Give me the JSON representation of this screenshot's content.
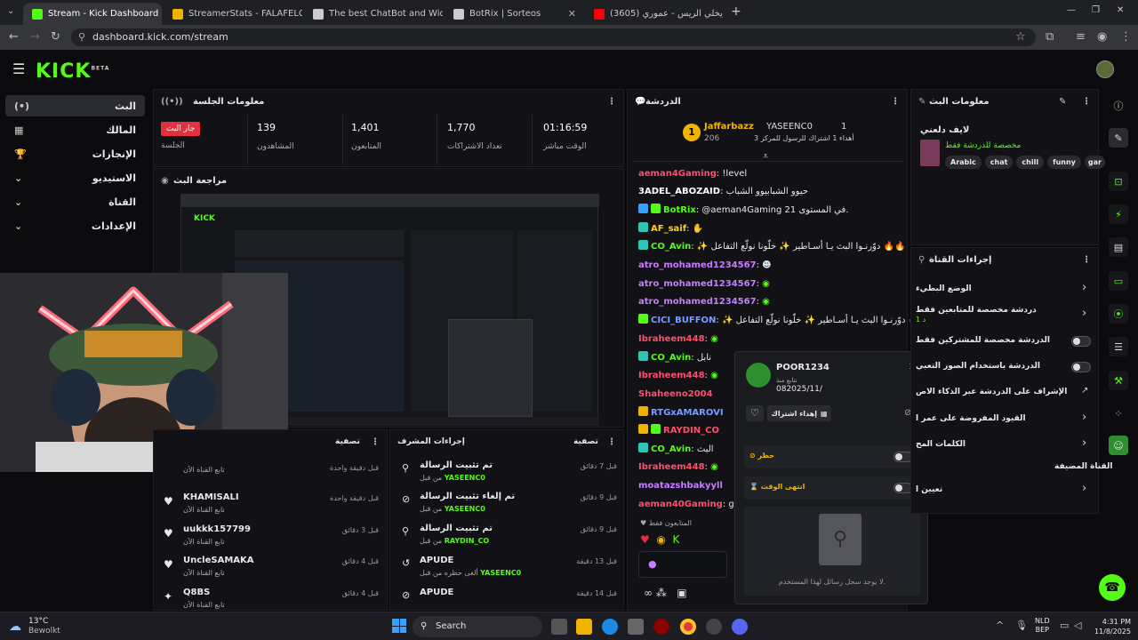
{
  "browser": {
    "tabs": [
      {
        "title": "Stream - Kick Dashboard",
        "color": "#53fc18"
      },
      {
        "title": "StreamerStats - FALAFELCO Pro",
        "color": "#f0b400"
      },
      {
        "title": "The best ChatBot and Widgets",
        "color": "#cccccc"
      },
      {
        "title": "BotRix | Sorteos",
        "color": "#cccccc"
      },
      {
        "title": "(3605) الله يخلي الريس - عموري",
        "color": "#ff0000"
      }
    ],
    "url": "dashboard.kick.com/stream"
  },
  "kick": {
    "logo": "KICK",
    "logo_sup": "BETA"
  },
  "sidebar": {
    "items": [
      {
        "label": "البث",
        "icon": "(•)"
      },
      {
        "label": "المالك",
        "icon": "▦"
      },
      {
        "label": "الإنجازات",
        "icon": "🏆"
      },
      {
        "label": "الاستيديو",
        "icon": "⌄"
      },
      {
        "label": "القناة",
        "icon": "⌄"
      },
      {
        "label": "الإعدادات",
        "icon": "⌄"
      }
    ]
  },
  "session": {
    "title": "معلومات الجلسة",
    "live_badge": "جار البث",
    "live_label": "الجلسة",
    "stats": [
      {
        "value": "139",
        "label": "المشاهدون"
      },
      {
        "value": "1,401",
        "label": "المتابعون"
      },
      {
        "value": "1,770",
        "label": "تعداد الاشتراكات"
      },
      {
        "value": "01:16:59",
        "label": "الوقت مباشر"
      }
    ]
  },
  "preview": {
    "title": "مراجعة البث"
  },
  "feed_left": {
    "title": "تصفية",
    "items": [
      {
        "name": "",
        "sub": "تابع القناة الآن",
        "time": "قبل دقيقة واحدة"
      },
      {
        "name": "",
        "sub": "تابع القناة الآن",
        "time": "قبل دقيقة واحدة"
      },
      {
        "name": "KHAMISALI",
        "sub": "تابع القناة الآن",
        "time": "قبل دقيقة واحدة"
      },
      {
        "name": "uukkk157799",
        "sub": "تابع القناة الآن",
        "time": "قبل 3 دقائق"
      },
      {
        "name": "UncleSAMAKA",
        "sub": "تابع القناة الآن",
        "time": "قبل 4 دقائق"
      },
      {
        "name": "Q8BS",
        "sub": "تابع القناة الآن",
        "time": "قبل 4 دقائق"
      }
    ]
  },
  "feed_mod": {
    "title": "إجراءات المشرف",
    "filter": "تصفية",
    "items": [
      {
        "name": "تم تثبيت الرسالة",
        "sub": "YASEENC0",
        "pre": "من قبل",
        "time": "قبل 7 دقائق"
      },
      {
        "name": "تم إلغاء تثبيت الرسالة",
        "sub": "YASEENC0",
        "pre": "من قبل",
        "time": "قبل 9 دقائق"
      },
      {
        "name": "تم تثبيت الرسالة",
        "sub": "RAYDIN_CO",
        "pre": "من قبل",
        "time": "قبل 9 دقائق"
      },
      {
        "name": "APUDE",
        "sub": "YASEENC0",
        "pre": "ألغى حظره من قبل",
        "time": "قبل 13 دقيقة"
      },
      {
        "name": "APUDE",
        "sub": "YASEENC0",
        "pre": "",
        "time": "قبل 14 دقيقة"
      }
    ]
  },
  "chat": {
    "title": "الدردشة",
    "top_user": "Jaffarbazz",
    "top_rank": "1",
    "top_value": "206",
    "second_user": "YASEENC0",
    "second_rank": "1",
    "second_sub": "3 أهداء 1 اشتراك للرسول للمركز",
    "messages": [
      {
        "user": "aeman4Gaming",
        "color": "#ff4d6d",
        "text": "!level"
      },
      {
        "user": "3ADEL_ABOZAID",
        "color": "#ffffff",
        "text": "حيوو الشبابيوو الشباب"
      },
      {
        "user": "BotRix",
        "color": "#53fc18",
        "text": "@aeman4Gaming 21 في المستوى."
      },
      {
        "user": "AF_saif",
        "color": "#ffd400",
        "text": ""
      },
      {
        "user": "CO_Avin",
        "color": "#53fc18",
        "text": "✨ دوّرنـوا البث يـا أسـاطير ✨ خلّونا نولّع التفاعل 🔥🔥"
      },
      {
        "user": "atro_mohamed1234567",
        "color": "#c77dff",
        "text": ""
      },
      {
        "user": "atro_mohamed1234567",
        "color": "#c77dff",
        "text": ""
      },
      {
        "user": "atro_mohamed1234567",
        "color": "#c77dff",
        "text": ""
      },
      {
        "user": "CICI_BUFFON",
        "color": "#7b9cff",
        "text": "✨ دوّرنـوا البث يـا أسـاطير ✨ خلّونا نولّع التفاعل 🔥🔥"
      },
      {
        "user": "Ibraheem448",
        "color": "#ff4d6d",
        "text": ""
      },
      {
        "user": "CO_Avin",
        "color": "#53fc18",
        "text": "نابل"
      },
      {
        "user": "Ibraheem448",
        "color": "#ff4d6d",
        "text": ""
      },
      {
        "user": "Shaheeno2004",
        "color": "#ff4d6d",
        "text": ""
      },
      {
        "user": "RTGxAMAROVI",
        "color": "#7b9cff",
        "text": ""
      },
      {
        "user": "RAYDIN_CO",
        "color": "#ff4d6d",
        "text": ""
      },
      {
        "user": "CO_Avin",
        "color": "#53fc18",
        "text": "البث"
      },
      {
        "user": "Ibraheem448",
        "color": "#ff4d6d",
        "text": ""
      },
      {
        "user": "moatazshbakyyll",
        "color": "#c77dff",
        "text": ""
      },
      {
        "user": "aeman40Gaming",
        "color": "#ff4d6d",
        "text": "gg"
      }
    ],
    "followers_only": "المتابعون فقط"
  },
  "popup": {
    "user": "POOR1234",
    "since_label": "تتابع منذ",
    "since": "082025/11/",
    "gift_button": "إهداء اشتراك",
    "ban_label": "حظر",
    "timeout_label": "انتهى الوقت",
    "empty": "لا يوجد سجل رسائل لهذا المستخدم."
  },
  "stream_info": {
    "title": "معلومات البث",
    "stream_title": "لايف دلعني",
    "category": "مخصصة للدردشة فقط",
    "tags": [
      "Arabic",
      "chat",
      "chill",
      "funny",
      "gar"
    ]
  },
  "channel_actions": {
    "title": "إجراءات القناة",
    "items": [
      {
        "label": "الوضع البطيء",
        "kind": "chevron"
      },
      {
        "label": "دردشة مخصصة للمتابعين فقط",
        "sub": "1 د",
        "kind": "chevron"
      },
      {
        "label": "الدردشة مخصصة للمشتركين فقط",
        "kind": "toggle"
      },
      {
        "label": "الدردشة باستخدام الصور التعبي",
        "kind": "toggle"
      },
      {
        "label": "الإشراف على الدردشة عبر الذكاء الاص",
        "kind": "external"
      },
      {
        "label": "القيود المفروضة على عمر ا",
        "kind": "chevron"
      },
      {
        "label": "الكلمات المح",
        "kind": "chevron"
      },
      {
        "label": "القناة المضيفة",
        "kind": "none"
      },
      {
        "label": "تعيين ا",
        "kind": "chevron"
      }
    ]
  },
  "taskbar": {
    "weather_temp": "13°C",
    "weather_desc": "Bewolkt",
    "search": "Search",
    "lang": "NLD",
    "lang2": "BEP",
    "time": "4:31 PM",
    "date": "11/8/2025"
  }
}
